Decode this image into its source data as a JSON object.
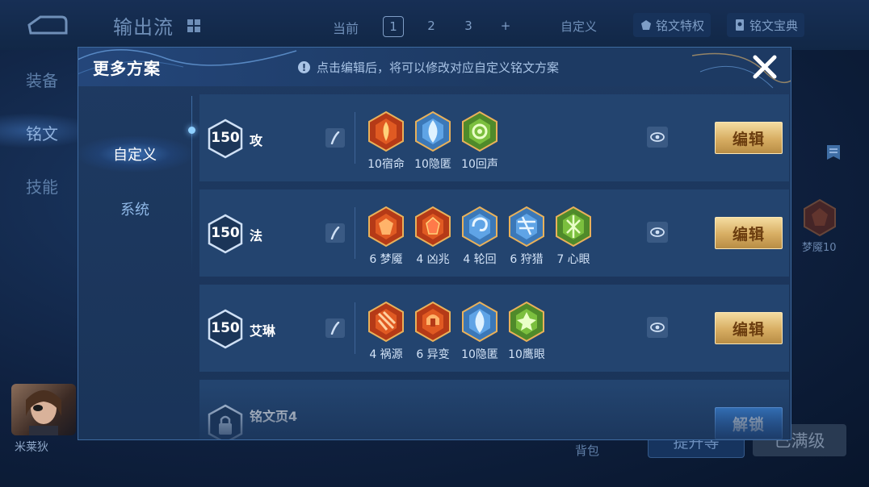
{
  "background": {
    "title": "输出流",
    "current_label": "当前",
    "pages": [
      "1",
      "2",
      "3",
      "+"
    ],
    "custom_label": "自定义",
    "privilege_label": "铭文特权",
    "codex_label": "铭文宝典",
    "side_tabs": [
      "装备",
      "铭文",
      "技能"
    ],
    "right_rune_label": "梦魇10",
    "avatar_name": "米莱狄",
    "backpack_label": "背包",
    "upgrade_label": "提升等",
    "maxed_label": "已满级"
  },
  "modal": {
    "title": "更多方案",
    "notice": "点击编辑后，将可以修改对应自定义铭文方案",
    "tabs": [
      {
        "label": "自定义",
        "active": true
      },
      {
        "label": "系统",
        "active": false
      }
    ],
    "rows": [
      {
        "level": "150",
        "name": "攻",
        "runes": [
          {
            "label": "10宿命",
            "icon": "fate-rune-icon",
            "color": "#c9431c"
          },
          {
            "label": "10隐匿",
            "icon": "stealth-rune-icon",
            "color": "#4f8fc9"
          },
          {
            "label": "10回声",
            "icon": "echo-rune-icon",
            "color": "#6ea23a"
          }
        ],
        "button": "编辑"
      },
      {
        "level": "150",
        "name": "法",
        "runes": [
          {
            "label": "6 梦魇",
            "icon": "nightmare-rune-icon",
            "color": "#c9431c"
          },
          {
            "label": "4 凶兆",
            "icon": "omen-rune-icon",
            "color": "#c9431c"
          },
          {
            "label": "4 轮回",
            "icon": "reincarnation-rune-icon",
            "color": "#4f8fc9"
          },
          {
            "label": "6 狩猎",
            "icon": "hunt-rune-icon",
            "color": "#4f8fc9"
          },
          {
            "label": "7 心眼",
            "icon": "mind-eye-rune-icon",
            "color": "#6ea23a"
          }
        ],
        "button": "编辑"
      },
      {
        "level": "150",
        "name": "艾琳",
        "runes": [
          {
            "label": "4 祸源",
            "icon": "calamity-rune-icon",
            "color": "#c9431c"
          },
          {
            "label": "6 异变",
            "icon": "mutation-rune-icon",
            "color": "#c9431c"
          },
          {
            "label": "10隐匿",
            "icon": "stealth-rune-icon",
            "color": "#4f8fc9"
          },
          {
            "label": "10鹰眼",
            "icon": "eagle-eye-rune-icon",
            "color": "#6ea23a"
          }
        ],
        "button": "编辑"
      },
      {
        "locked": true,
        "name": "铭文页4",
        "button": "解锁"
      }
    ]
  },
  "colors": {
    "gold_button": "#d7ad62",
    "blue_button": "#2a64b5",
    "panel": "#23446f"
  }
}
